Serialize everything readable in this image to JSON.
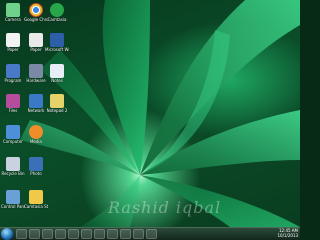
{
  "desktop_icons": [
    {
      "label": "Camera",
      "icon": "camera-icon",
      "color": "#6fd18a"
    },
    {
      "label": "Google Chrome",
      "icon": "chrome-icon",
      "color": "#e4c238"
    },
    {
      "label": "Camtasia",
      "icon": "camtasia-icon",
      "color": "#27a64a"
    },
    {
      "label": "Paper",
      "icon": "document-icon",
      "color": "#f2f2f2"
    },
    {
      "label": "Paper",
      "icon": "document-icon",
      "color": "#e9e9e9"
    },
    {
      "label": "Microsoft Word",
      "icon": "word-icon",
      "color": "#2f5ea8"
    },
    {
      "label": "Program",
      "icon": "app-icon",
      "color": "#4a79c8"
    },
    {
      "label": "Hardware",
      "icon": "app-icon",
      "color": "#7a8aa6"
    },
    {
      "label": "Notes",
      "icon": "notepad-icon",
      "color": "#e8eef5"
    },
    {
      "label": "Files",
      "icon": "files-icon",
      "color": "#b64d9c"
    },
    {
      "label": "Network",
      "icon": "network-icon",
      "color": "#3b79c6"
    },
    {
      "label": "Notepad 2",
      "icon": "notepad-icon",
      "color": "#e5d36a"
    },
    {
      "label": "Computer",
      "icon": "computer-icon",
      "color": "#4d8fd8"
    },
    {
      "label": "Media",
      "icon": "media-icon",
      "color": "#f08c2a"
    },
    {
      "label": "Recycle Bin",
      "icon": "recycle-bin-icon",
      "color": "#c8d3df"
    },
    {
      "label": "Photo",
      "icon": "photo-icon",
      "color": "#3b6fb6"
    },
    {
      "label": "Control Panel",
      "icon": "control-panel-icon",
      "color": "#6aa0d8"
    },
    {
      "label": "Camtasia Studio 7",
      "icon": "camtasia-icon",
      "color": "#f0c84a"
    }
  ],
  "watermark": "Rashid iqbal",
  "taskbar": {
    "buttons": [
      "internet-explorer-icon",
      "folder-icon",
      "media-player-icon",
      "chrome-icon",
      "firefox-icon",
      "word-icon",
      "app-icon",
      "camtasia-icon",
      "paint-icon",
      "app-icon",
      "word-icon"
    ],
    "tray_time": "12:45 AM",
    "tray_date": "10/1/2013"
  }
}
